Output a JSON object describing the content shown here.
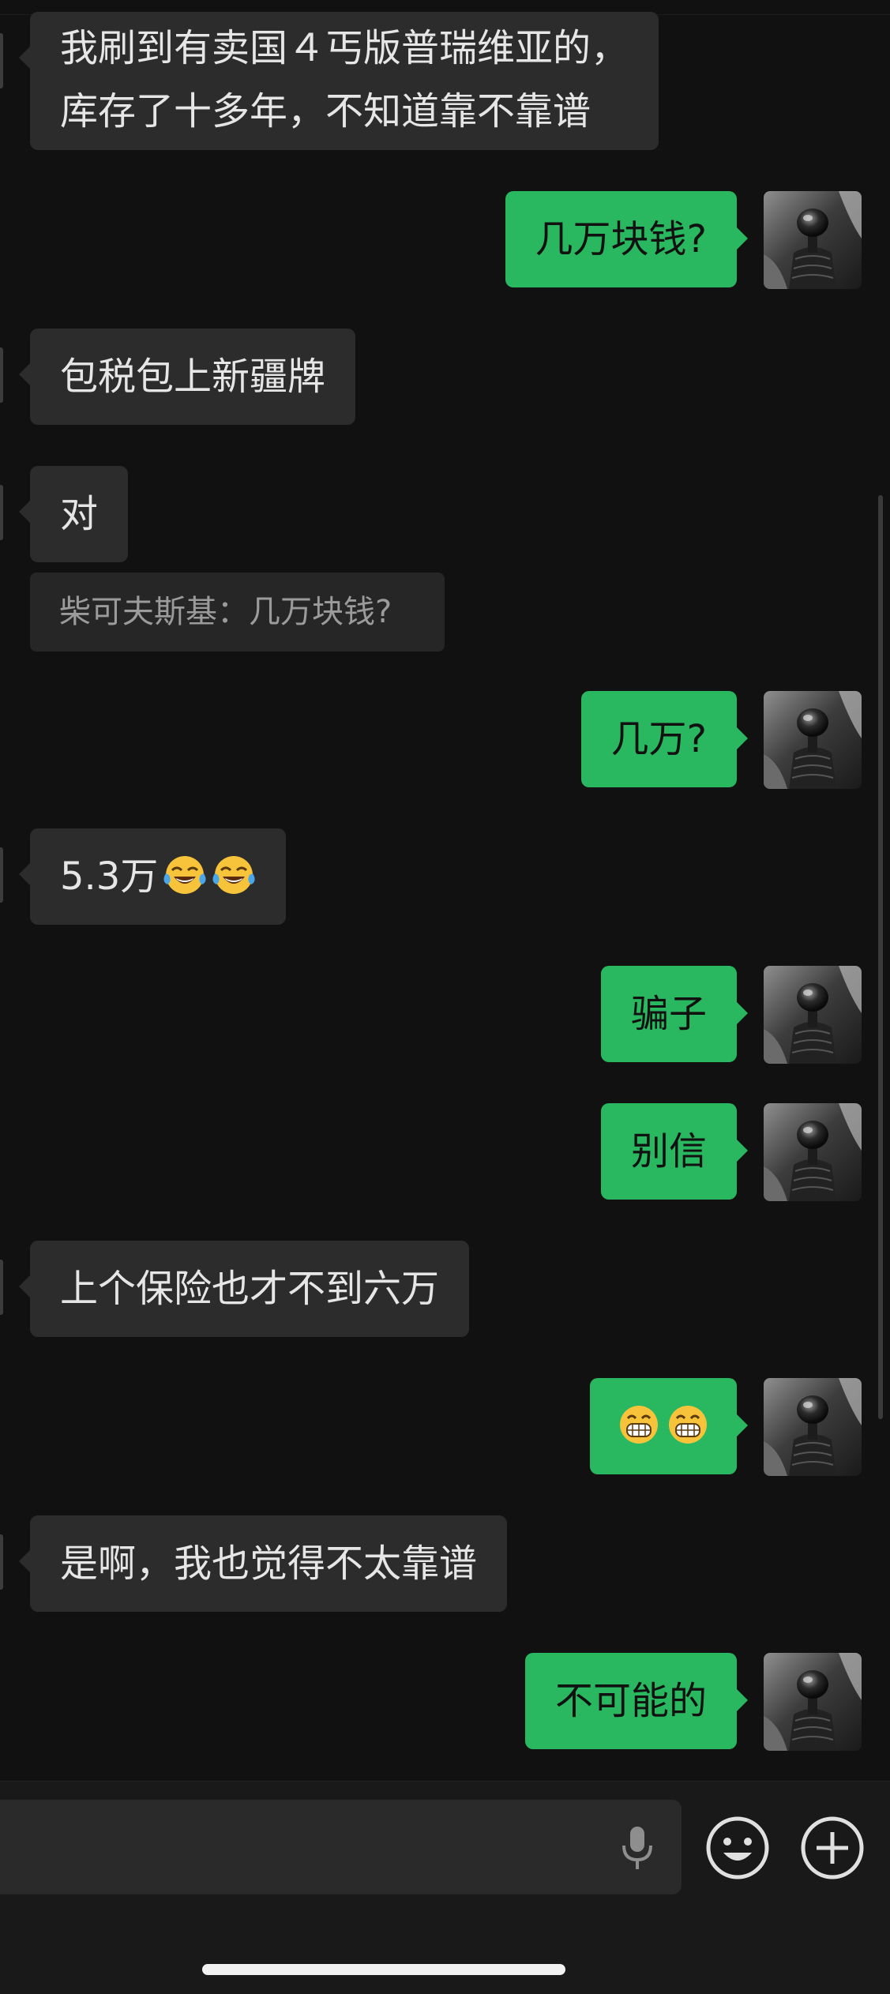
{
  "chat": {
    "messages": [
      {
        "side": "in",
        "lines": [
          "我刷到有卖国４丐版普瑞维亚的，",
          "库存了十多年，不知道靠不靠谱"
        ]
      },
      {
        "side": "out",
        "text": "几万块钱?"
      },
      {
        "side": "in",
        "text": "包税包上新疆牌"
      },
      {
        "side": "in",
        "text": "对",
        "quote": "柴可夫斯基：几万块钱?"
      },
      {
        "side": "out",
        "text": "几万?"
      },
      {
        "side": "in",
        "text": "5.3万",
        "emoji": [
          "face-with-tears-of-joy",
          "face-with-tears-of-joy"
        ]
      },
      {
        "side": "out",
        "text": "骗子"
      },
      {
        "side": "out",
        "text": "别信"
      },
      {
        "side": "in",
        "text": "上个保险也才不到六万"
      },
      {
        "side": "out",
        "text": "",
        "emoji": [
          "grinning-face-with-smiling-eyes",
          "grinning-face-with-smiling-eyes"
        ]
      },
      {
        "side": "in",
        "text": "是啊，我也觉得不太靠谱"
      },
      {
        "side": "out",
        "text": "不可能的"
      }
    ]
  },
  "input_bar": {
    "text_value": "",
    "icons": [
      "microphone-icon",
      "emoji-icon",
      "plus-icon"
    ]
  },
  "colors": {
    "background": "#111111",
    "incoming_bubble": "#2c2c2c",
    "outgoing_bubble": "#29b860",
    "incoming_text": "#e6e6e6",
    "quote_text": "#9b9b9b"
  }
}
